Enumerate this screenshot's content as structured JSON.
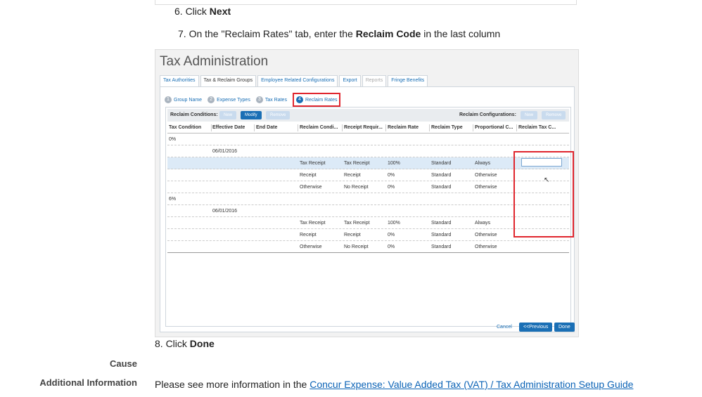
{
  "steps": {
    "s6": {
      "num": "6. Click ",
      "bold": "Next"
    },
    "s7": {
      "num": "7. On the \"Reclaim Rates\" tab, enter the ",
      "bold": "Reclaim Code",
      "tail": " in the last column"
    },
    "s8": {
      "num": "8. Click ",
      "bold": "Done"
    }
  },
  "screenshot": {
    "title": "Tax Administration",
    "tabs": [
      {
        "label": "Tax Authorities",
        "state": "normal"
      },
      {
        "label": "Tax & Reclaim Groups",
        "state": "active"
      },
      {
        "label": "Employee Related Configurations",
        "state": "normal"
      },
      {
        "label": "Export",
        "state": "normal"
      },
      {
        "label": "Reports",
        "state": "disabled"
      },
      {
        "label": "Fringe Benefits",
        "state": "normal"
      }
    ],
    "wizard": [
      {
        "num": "1",
        "label": "Group Name"
      },
      {
        "num": "2",
        "label": "Expense Types"
      },
      {
        "num": "3",
        "label": "Tax Rates"
      },
      {
        "num": "4",
        "label": "Reclaim Rates"
      }
    ],
    "toolbar": {
      "conditions_label": "Reclaim Conditions:",
      "configurations_label": "Reclaim Configurations:",
      "new": "New",
      "modify": "Modify",
      "remove": "Remove"
    },
    "columns": [
      "Tax Condition",
      "Effective Date",
      "End Date",
      "Reclaim Condi...",
      "Receipt Requir...",
      "Reclaim Rate",
      "Reclaim Type",
      "Proportional C...",
      "Reclaim Tax C..."
    ],
    "rows": [
      {
        "tax_condition": "0%",
        "effective_date": "",
        "reclaim_condition": "",
        "receipt": "",
        "rate": "",
        "type": "",
        "proportional": ""
      },
      {
        "tax_condition": "",
        "effective_date": "06/01/2016",
        "reclaim_condition": "",
        "receipt": "",
        "rate": "",
        "type": "",
        "proportional": ""
      },
      {
        "tax_condition": "",
        "effective_date": "",
        "reclaim_condition": "Tax Receipt",
        "receipt": "Tax Receipt",
        "rate": "100%",
        "type": "Standard",
        "proportional": "Always"
      },
      {
        "tax_condition": "",
        "effective_date": "",
        "reclaim_condition": "Receipt",
        "receipt": "Receipt",
        "rate": "0%",
        "type": "Standard",
        "proportional": "Otherwise"
      },
      {
        "tax_condition": "",
        "effective_date": "",
        "reclaim_condition": "Otherwise",
        "receipt": "No Receipt",
        "rate": "0%",
        "type": "Standard",
        "proportional": "Otherwise"
      },
      {
        "tax_condition": "6%",
        "effective_date": "",
        "reclaim_condition": "",
        "receipt": "",
        "rate": "",
        "type": "",
        "proportional": ""
      },
      {
        "tax_condition": "",
        "effective_date": "06/01/2016",
        "reclaim_condition": "",
        "receipt": "",
        "rate": "",
        "type": "",
        "proportional": ""
      },
      {
        "tax_condition": "",
        "effective_date": "",
        "reclaim_condition": "Tax Receipt",
        "receipt": "Tax Receipt",
        "rate": "100%",
        "type": "Standard",
        "proportional": "Always"
      },
      {
        "tax_condition": "",
        "effective_date": "",
        "reclaim_condition": "Receipt",
        "receipt": "Receipt",
        "rate": "0%",
        "type": "Standard",
        "proportional": "Otherwise"
      },
      {
        "tax_condition": "",
        "effective_date": "",
        "reclaim_condition": "Otherwise",
        "receipt": "No Receipt",
        "rate": "0%",
        "type": "Standard",
        "proportional": "Otherwise"
      }
    ],
    "footer": {
      "cancel": "Cancel",
      "previous": "<<Previous",
      "done": "Done"
    },
    "highlight_color": "#e0262e",
    "accent_color": "#1a6fb5"
  },
  "cause_label": "Cause",
  "additional": {
    "label": "Additional Information",
    "text": "Please see more information in the ",
    "link": "Concur Expense: Value Added Tax (VAT) / Tax Administration Setup Guide"
  }
}
